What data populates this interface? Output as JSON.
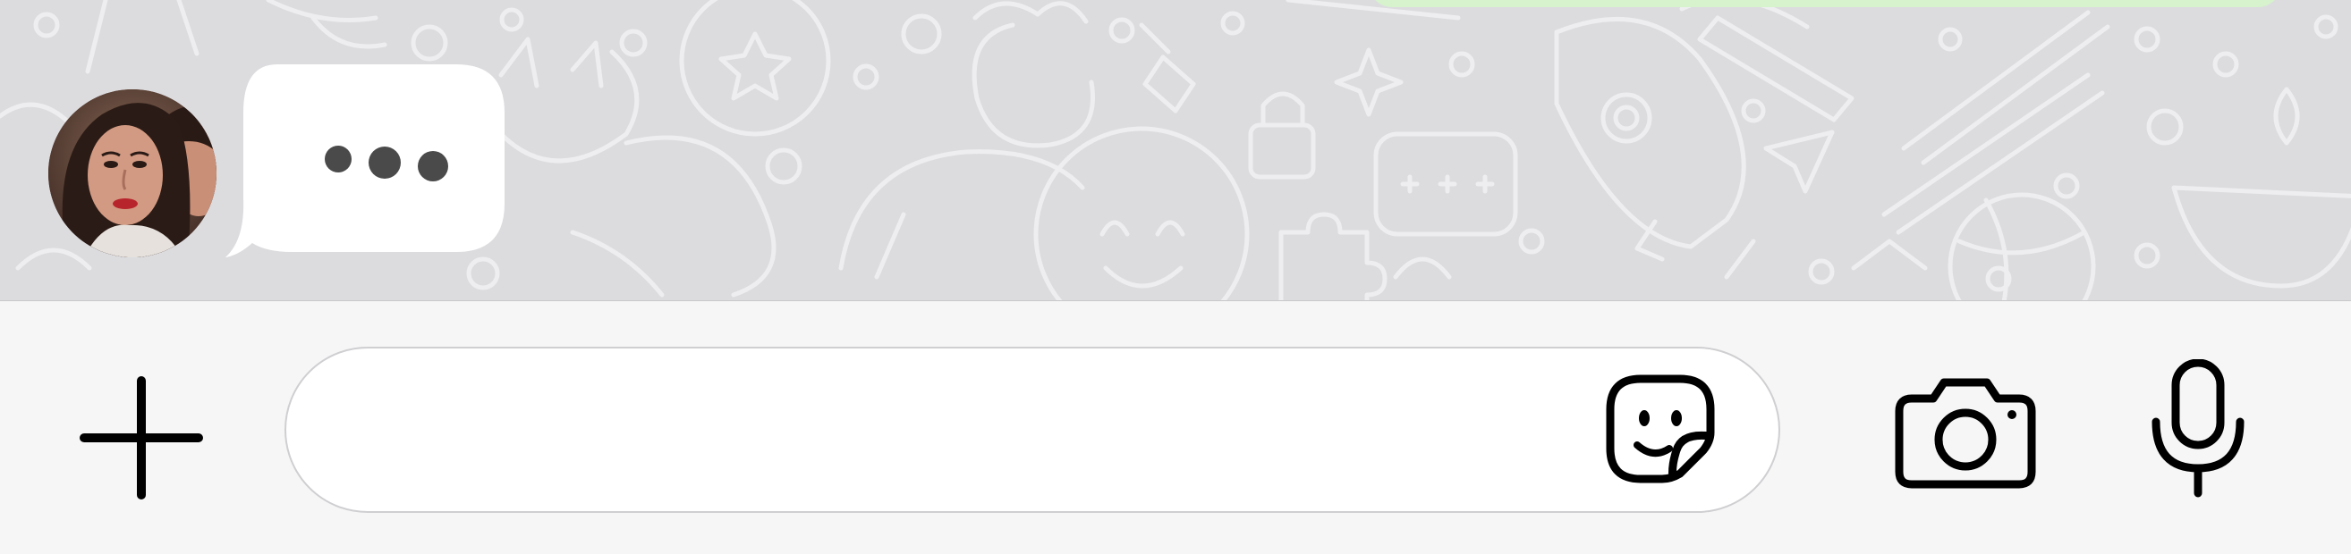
{
  "colors": {
    "chat_background": "#dcdcdf",
    "doodle_stroke": "#eeeef0",
    "bubble_background": "#ffffff",
    "typing_dots": "#4a4a4a",
    "outgoing_bubble": "#d6f3cd",
    "composer_background": "#f6f6f6",
    "icon_color": "#000000",
    "input_border": "#cfcfd2"
  },
  "contact": {
    "avatar_icon": "contact-avatar-photo"
  },
  "typing_indicator": {
    "icon": "ellipsis-typing-dots",
    "dot_count": 3
  },
  "composer": {
    "attach_icon": "plus-icon",
    "message_value": "",
    "message_placeholder": "",
    "sticker_icon": "sticker-icon",
    "camera_icon": "camera-icon",
    "mic_icon": "microphone-icon"
  }
}
